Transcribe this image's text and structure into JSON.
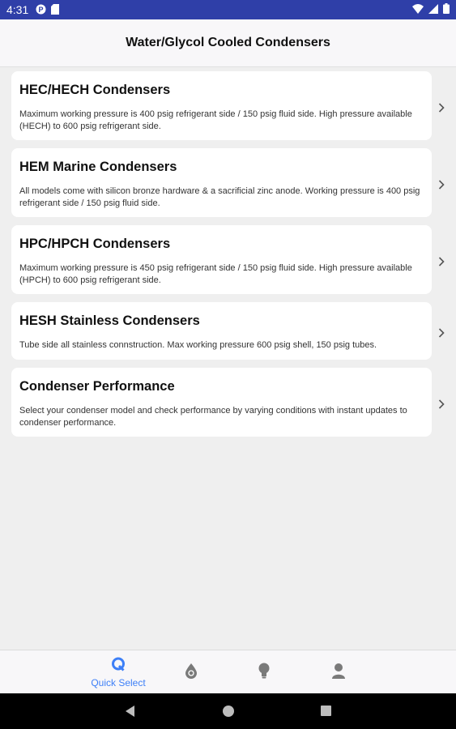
{
  "status_bar": {
    "time": "4:31"
  },
  "header": {
    "title": "Water/Glycol Cooled Condensers"
  },
  "cards": [
    {
      "title": "HEC/HECH Condensers",
      "description": "Maximum working pressure is 400 psig refrigerant side / 150 psig fluid side. High pressure available (HECH) to 600 psig refrigerant side."
    },
    {
      "title": "HEM Marine Condensers",
      "description": "All models come with silicon bronze hardware & a sacrificial zinc anode. Working pressure is 400 psig refrigerant side / 150 psig fluid side."
    },
    {
      "title": "HPC/HPCH Condensers",
      "description": "Maximum working pressure is 450 psig refrigerant side / 150 psig fluid side. High pressure available (HPCH) to 600 psig refrigerant side."
    },
    {
      "title": "HESH Stainless Condensers",
      "description": "Tube side all stainless connstruction. Max working pressure 600 psig shell, 150 psig tubes."
    },
    {
      "title": "Condenser Performance",
      "description": "Select your condenser model and check performance by varying conditions with instant updates to condenser performance."
    }
  ],
  "tabbar": {
    "tabs": [
      {
        "label": "Quick Select",
        "icon": "quick-select-icon",
        "active": true
      },
      {
        "label": "",
        "icon": "drop-icon",
        "active": false
      },
      {
        "label": "",
        "icon": "lightbulb-icon",
        "active": false
      },
      {
        "label": "",
        "icon": "person-icon",
        "active": false
      }
    ]
  },
  "colors": {
    "status_bar": "#2f3fa8",
    "accent": "#3d7ff7",
    "icon_gray": "#7a7a7a"
  }
}
